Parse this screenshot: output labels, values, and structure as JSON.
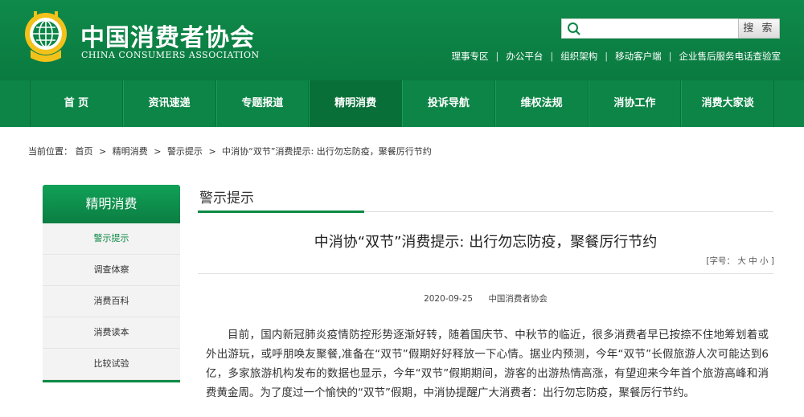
{
  "header": {
    "brand_cn": "中国消费者协会",
    "brand_en": "CHINA CONSUMERS ASSOCIATION",
    "search_placeholder": "",
    "search_button": "搜 索",
    "top_links": [
      "理事专区",
      "办公平台",
      "组织架构",
      "移动客户端",
      "企业售后服务电话查验室"
    ]
  },
  "nav": {
    "items": [
      "首  页",
      "资讯速递",
      "专题报道",
      "精明消费",
      "投诉导航",
      "维权法规",
      "消协工作",
      "消费大家谈"
    ],
    "active_index": 3
  },
  "breadcrumb": {
    "label": "当前位置：",
    "items": [
      "首页",
      "精明消费",
      "警示提示",
      "中消协“双节”消费提示: 出行勿忘防疫，聚餐厉行节约"
    ],
    "arrow": ">"
  },
  "sidebar": {
    "title": "精明消费",
    "items": [
      "警示提示",
      "调查体察",
      "消费百科",
      "消费读本",
      "比较试验"
    ],
    "active_index": 0
  },
  "section": {
    "title": "警示提示"
  },
  "article": {
    "title": "中消协“双节”消费提示: 出行勿忘防疫，聚餐厉行节约",
    "fontsize_prefix": "[字号：",
    "fontsize_large": "大",
    "fontsize_medium": "中",
    "fontsize_small": "小",
    "fontsize_suffix": "]",
    "date": "2020-09-25",
    "source": "中国消费者协会",
    "body": "目前，国内新冠肺炎疫情防控形势逐渐好转，随着国庆节、中秋节的临近，很多消费者早已按捺不住地筹划着或外出游玩，或呼朋唤友聚餐,准备在“双节”假期好好释放一下心情。据业内预测，今年“双节”长假旅游人次可能达到6亿，多家旅游机构发布的数据也显示，今年“双节”假期期间，游客的出游热情高涨，有望迎来今年首个旅游高峰和消费黄金周。为了度过一个愉快的“双节”假期，中消协提醒广大消费者：出行勿忘防疫，聚餐厉行节约。"
  },
  "colors": {
    "brand_green": "#0c8546",
    "accent_green": "#0b8a44"
  }
}
